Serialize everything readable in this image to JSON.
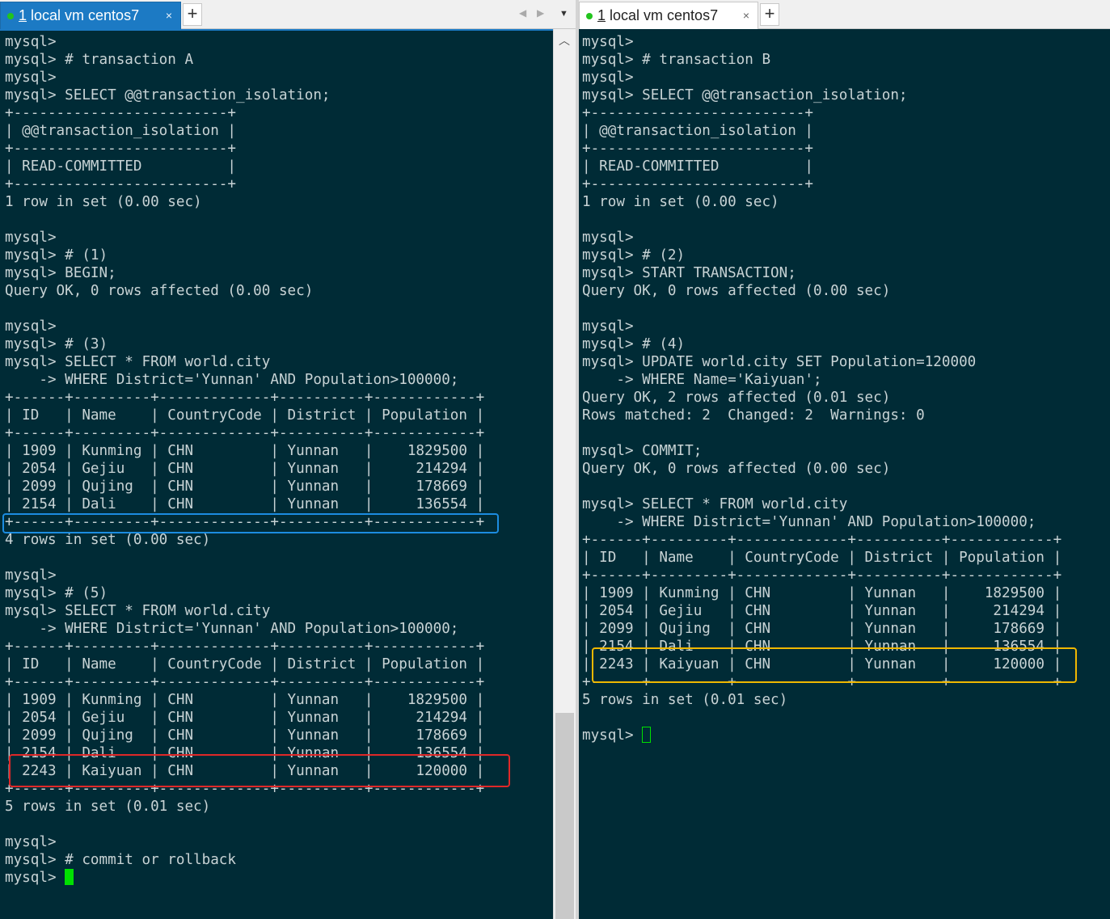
{
  "tabs": {
    "left": {
      "number": "1",
      "title": " local vm centos7",
      "close": "×",
      "new_tab": "+"
    },
    "right": {
      "number": "1",
      "title": " local vm centos7",
      "close": "×",
      "new_tab": "+"
    }
  },
  "colors": {
    "terminal_bg": "#002b36",
    "terminal_fg": "#c8d3d5",
    "active_tab": "#1c7ac4",
    "highlight_blue": "#1c8ce0",
    "highlight_red": "#e02828",
    "highlight_yellow": "#f0b800",
    "cursor": "#00e000"
  },
  "icons": {
    "nav_left": "chevron-left-icon",
    "nav_right": "chevron-right-icon",
    "tab_menu": "triangle-down-icon",
    "scroll_up": "chevron-up-icon"
  },
  "terminal_left": {
    "output": "mysql>\nmysql> # transaction A\nmysql>\nmysql> SELECT @@transaction_isolation;\n+-------------------------+\n| @@transaction_isolation |\n+-------------------------+\n| READ-COMMITTED          |\n+-------------------------+\n1 row in set (0.00 sec)\n\nmysql>\nmysql> # (1)\nmysql> BEGIN;\nQuery OK, 0 rows affected (0.00 sec)\n\nmysql>\nmysql> # (3)\nmysql> SELECT * FROM world.city\n    -> WHERE District='Yunnan' AND Population>100000;\n+------+---------+-------------+----------+------------+\n| ID   | Name    | CountryCode | District | Population |\n+------+---------+-------------+----------+------------+\n| 1909 | Kunming | CHN         | Yunnan   |    1829500 |\n| 2054 | Gejiu   | CHN         | Yunnan   |     214294 |\n| 2099 | Qujing  | CHN         | Yunnan   |     178669 |\n| 2154 | Dali    | CHN         | Yunnan   |     136554 |\n+------+---------+-------------+----------+------------+\n4 rows in set (0.00 sec)\n\nmysql>\nmysql> # (5)\nmysql> SELECT * FROM world.city\n    -> WHERE District='Yunnan' AND Population>100000;\n+------+---------+-------------+----------+------------+\n| ID   | Name    | CountryCode | District | Population |\n+------+---------+-------------+----------+------------+\n| 1909 | Kunming | CHN         | Yunnan   |    1829500 |\n| 2054 | Gejiu   | CHN         | Yunnan   |     214294 |\n| 2099 | Qujing  | CHN         | Yunnan   |     178669 |\n| 2154 | Dali    | CHN         | Yunnan   |     136554 |\n| 2243 | Kaiyuan | CHN         | Yunnan   |     120000 |\n+------+---------+-------------+----------+------------+\n5 rows in set (0.01 sec)\n\nmysql>\nmysql> # commit or rollback\n",
    "prompt": "mysql> "
  },
  "terminal_right": {
    "output": "mysql>\nmysql> # transaction B\nmysql>\nmysql> SELECT @@transaction_isolation;\n+-------------------------+\n| @@transaction_isolation |\n+-------------------------+\n| READ-COMMITTED          |\n+-------------------------+\n1 row in set (0.00 sec)\n\nmysql>\nmysql> # (2)\nmysql> START TRANSACTION;\nQuery OK, 0 rows affected (0.00 sec)\n\nmysql>\nmysql> # (4)\nmysql> UPDATE world.city SET Population=120000\n    -> WHERE Name='Kaiyuan';\nQuery OK, 2 rows affected (0.01 sec)\nRows matched: 2  Changed: 2  Warnings: 0\n\nmysql> COMMIT;\nQuery OK, 0 rows affected (0.00 sec)\n\nmysql> SELECT * FROM world.city\n    -> WHERE District='Yunnan' AND Population>100000;\n+------+---------+-------------+----------+------------+\n| ID   | Name    | CountryCode | District | Population |\n+------+---------+-------------+----------+------------+\n| 1909 | Kunming | CHN         | Yunnan   |    1829500 |\n| 2054 | Gejiu   | CHN         | Yunnan   |     214294 |\n| 2099 | Qujing  | CHN         | Yunnan   |     178669 |\n| 2154 | Dali    | CHN         | Yunnan   |     136554 |\n| 2243 | Kaiyuan | CHN         | Yunnan   |     120000 |\n+------+---------+-------------+----------+------------+\n5 rows in set (0.01 sec)\n\n",
    "prompt": "mysql> "
  }
}
